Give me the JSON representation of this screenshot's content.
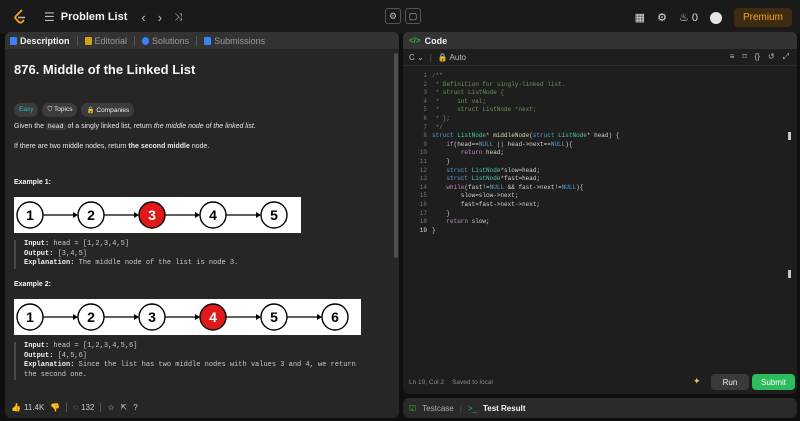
{
  "topbar": {
    "problem_list_label": "Problem List",
    "coins": "0",
    "premium_label": "Premium"
  },
  "left": {
    "tabs": [
      "Description",
      "Editorial",
      "Solutions",
      "Submissions"
    ],
    "title": "876. Middle of the Linked List",
    "chips": [
      "Easy",
      "Topics",
      "Companies"
    ],
    "p1_pre": "Given the ",
    "p1_code": "head",
    "p1_mid": " of a singly linked list, return ",
    "p1_em": "the middle node of the linked list",
    "p1_end": ".",
    "p2_pre": "If there are two middle nodes, return ",
    "p2_b": "the second middle",
    "p2_end": " node.",
    "ex1_title": "Example 1:",
    "ex1_nodes": [
      "1",
      "2",
      "3",
      "4",
      "5"
    ],
    "ex1_highlight": 2,
    "ex1_input_label": "Input:",
    "ex1_input": " head = [1,2,3,4,5]",
    "ex1_output_label": "Output:",
    "ex1_output": " [3,4,5]",
    "ex1_expl_label": "Explanation:",
    "ex1_expl": " The middle node of the list is node 3.",
    "ex2_title": "Example 2:",
    "ex2_nodes": [
      "1",
      "2",
      "3",
      "4",
      "5",
      "6"
    ],
    "ex2_highlight": 3,
    "ex2_input_label": "Input:",
    "ex2_input": " head = [1,2,3,4,5,6]",
    "ex2_output_label": "Output:",
    "ex2_output": " [4,5,6]",
    "ex2_expl_label": "Explanation:",
    "ex2_expl_1": " Since the list has two middle nodes with values 3 and 4, we return",
    "ex2_expl_2": "the second one.",
    "likes": "11.4K",
    "comments": "132",
    "node_red": "#e0191b"
  },
  "right": {
    "tab_label": "Code",
    "language": "C",
    "mode": "Auto",
    "code_lines": [
      "/**",
      " * Definition for singly-linked list.",
      " * struct ListNode {",
      " *     int val;",
      " *     struct ListNode *next;",
      " * };",
      " */",
      "struct ListNode* middleNode(struct ListNode* head) {",
      "    if(head==NULL || head->next==NULL){",
      "        return head;",
      "    }",
      "    struct ListNode*slow=head;",
      "    struct ListNode*fast=head;",
      "    while(fast!=NULL && fast->next!=NULL){",
      "        slow=slow->next;",
      "        fast=fast->next->next;",
      "    }",
      "    return slow;",
      "}"
    ],
    "cursor_pos": "Ln 19, Col 2",
    "saved_label": "Saved to local",
    "run_label": "Run",
    "submit_label": "Submit",
    "bottom_tabs": [
      "Testcase",
      "Test Result"
    ],
    "accent": "#2cbb5d"
  }
}
